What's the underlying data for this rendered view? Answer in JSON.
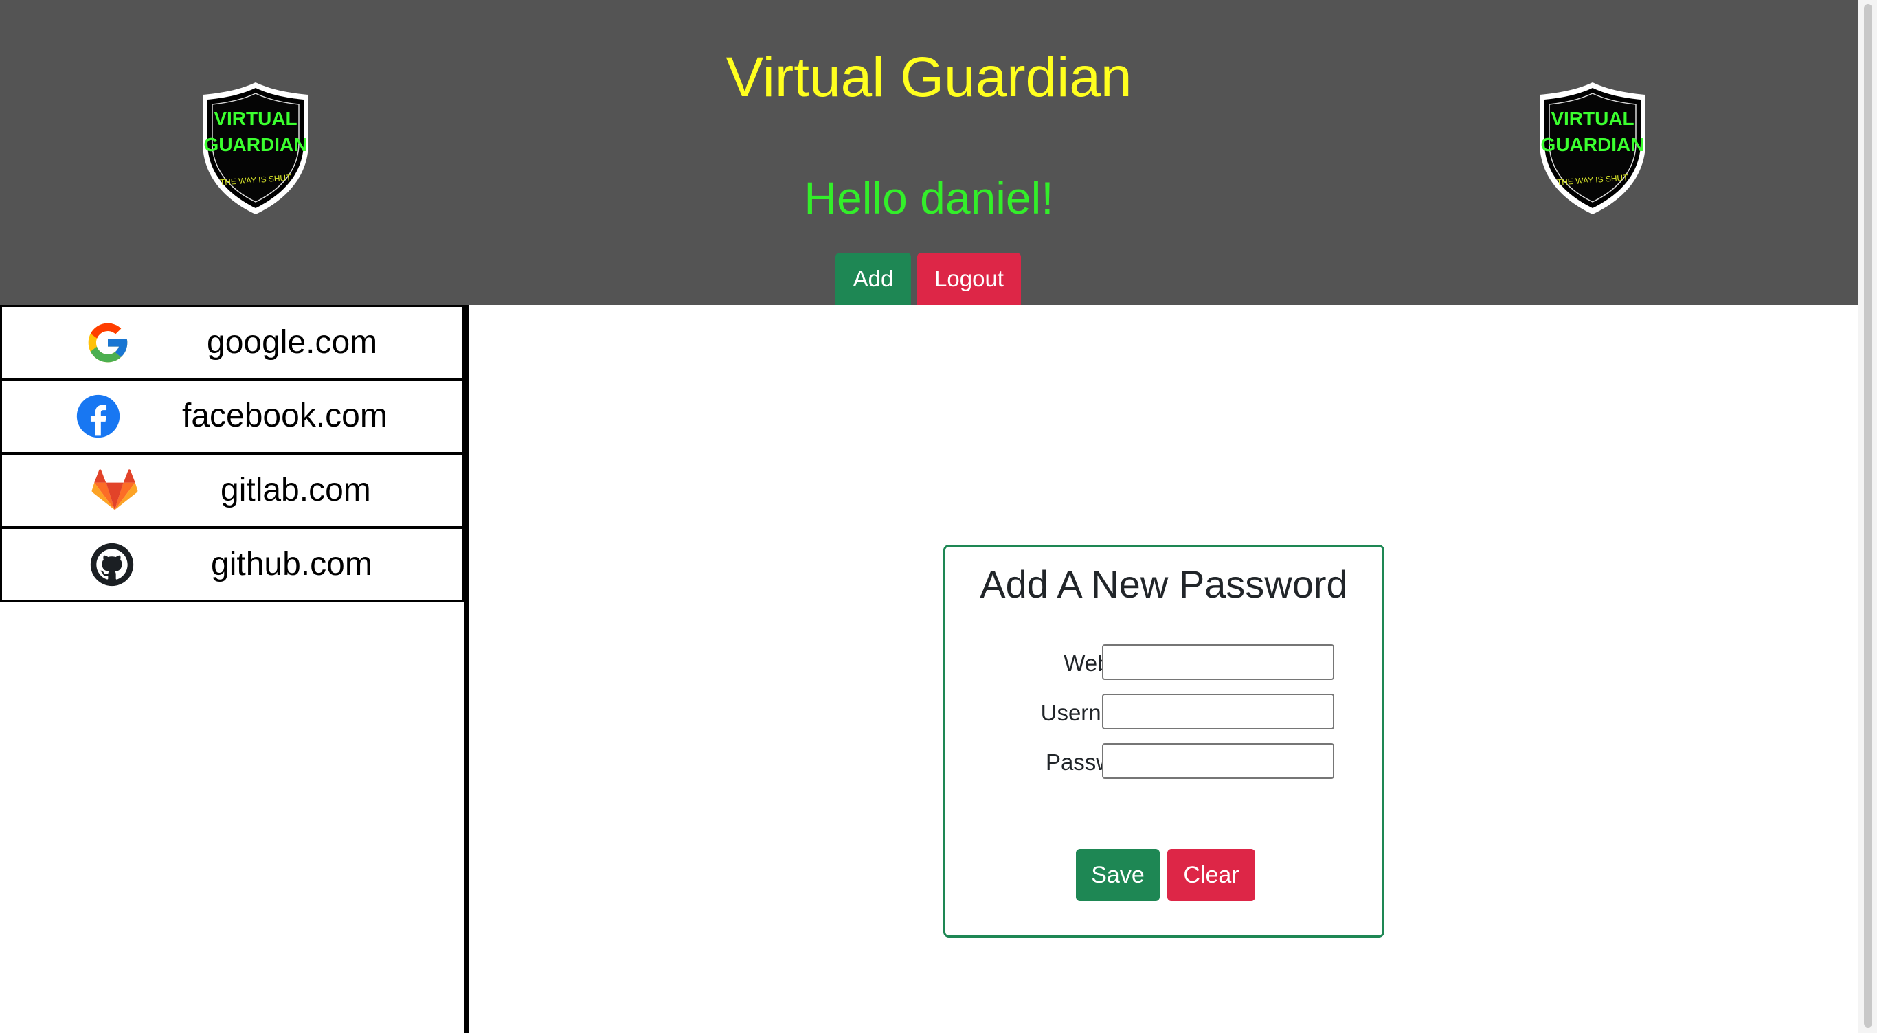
{
  "header": {
    "title": "Virtual Guardian",
    "greeting": "Hello daniel!",
    "add_label": "Add",
    "logout_label": "Logout",
    "logo": {
      "line1": "VIRTUAL",
      "line2": "GUARDIAN",
      "motto": "THE WAY IS SHUT"
    }
  },
  "sidebar": {
    "items": [
      {
        "label": "google.com",
        "icon": "google-icon"
      },
      {
        "label": "facebook.com",
        "icon": "facebook-icon"
      },
      {
        "label": "gitlab.com",
        "icon": "gitlab-icon"
      },
      {
        "label": "github.com",
        "icon": "github-icon"
      }
    ]
  },
  "form": {
    "title": "Add A New Password",
    "website_label": "Website:",
    "website_value": "",
    "username_label": "Username:",
    "username_value": "",
    "password_label": "Password:",
    "password_value": "",
    "save_label": "Save",
    "clear_label": "Clear"
  },
  "colors": {
    "header_bg": "#545454",
    "title": "#ffff1f",
    "greeting": "#33ee2a",
    "primary_green": "#1e8754",
    "danger_red": "#dd2647"
  }
}
